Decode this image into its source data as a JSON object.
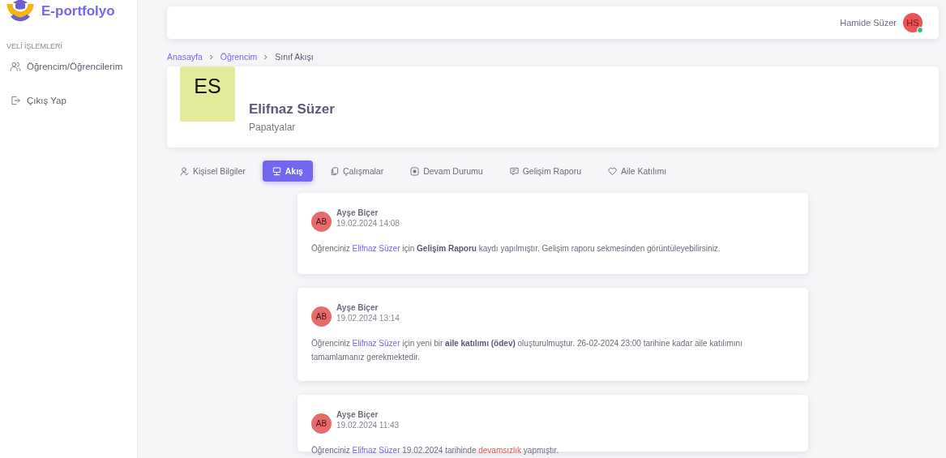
{
  "sidebar": {
    "logo_text": "E-portfolyo",
    "section_title": "VELİ İŞLEMLERİ",
    "items": [
      {
        "label": "Öğrencim/Öğrencilerim"
      },
      {
        "label": "Çıkış Yap"
      }
    ]
  },
  "topbar": {
    "user_name": "Hamide Süzer",
    "avatar_initials": "HS",
    "online": true
  },
  "breadcrumb": [
    {
      "label": "Anasayfa",
      "kind": "link"
    },
    {
      "label": "Öğrencim",
      "kind": "link"
    },
    {
      "label": "Sınıf Akışı",
      "kind": "current"
    }
  ],
  "profile": {
    "initials": "ES",
    "name": "Elifnaz Süzer",
    "class": "Papatyalar"
  },
  "tabs": [
    {
      "label": "Kişisel Bilgiler",
      "selected": false
    },
    {
      "label": "Akış",
      "selected": true
    },
    {
      "label": "Çalışmalar",
      "selected": false
    },
    {
      "label": "Devam Durumu",
      "selected": false
    },
    {
      "label": "Gelişim Raporu",
      "selected": false
    },
    {
      "label": "Aile Katılımı",
      "selected": false
    }
  ],
  "posts": [
    {
      "author_initials": "AB",
      "author": "Ayşe Biçer",
      "time": "19.02.2024 14:08",
      "body": [
        {
          "kind": "plain",
          "text": "Öğrenciniz "
        },
        {
          "kind": "link",
          "text": "Elifnaz Süzer"
        },
        {
          "kind": "plain",
          "text": " için "
        },
        {
          "kind": "bold",
          "text": "Gelişim Raporu"
        },
        {
          "kind": "plain",
          "text": " kaydı yapılmıştır. Gelişim raporu sekmesinden görüntüleyebilirsiniz."
        }
      ]
    },
    {
      "author_initials": "AB",
      "author": "Ayşe Biçer",
      "time": "19.02.2024 13:14",
      "body": [
        {
          "kind": "plain",
          "text": "Öğrenciniz "
        },
        {
          "kind": "link",
          "text": "Elifnaz Süzer"
        },
        {
          "kind": "plain",
          "text": " için yeni bir "
        },
        {
          "kind": "bold",
          "text": "aile katılımı (ödev)"
        },
        {
          "kind": "plain",
          "text": " oluşturulmuştur. 26-02-2024 23:00 tarihine kadar aile katılımını tamamlamanız gerekmektedir."
        }
      ]
    },
    {
      "author_initials": "AB",
      "author": "Ayşe Biçer",
      "time": "19.02.2024 11:43",
      "body": [
        {
          "kind": "plain",
          "text": "Öğrenciniz "
        },
        {
          "kind": "link",
          "text": "Elifnaz Süzer"
        },
        {
          "kind": "plain",
          "text": " 19.02.2024 tarihinde "
        },
        {
          "kind": "alert",
          "text": "devamsızlık"
        },
        {
          "kind": "plain",
          "text": " yapmıştır."
        }
      ]
    }
  ]
}
